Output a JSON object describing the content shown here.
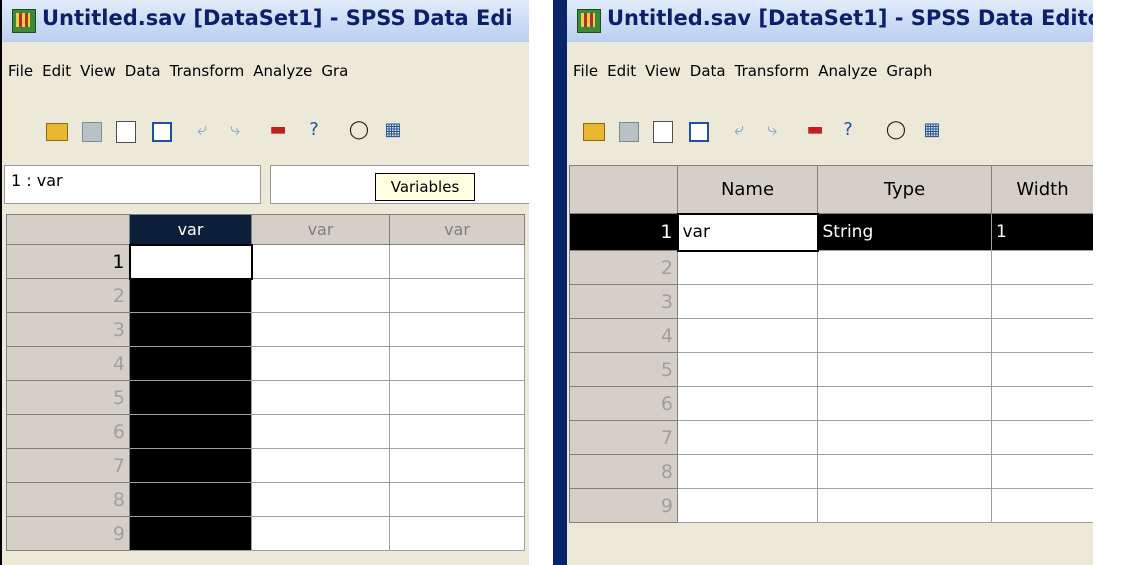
{
  "left_window": {
    "title": "Untitled.sav [DataSet1] - SPSS Data Edi",
    "menu": [
      "File",
      "Edit",
      "View",
      "Data",
      "Transform",
      "Analyze",
      "Gra"
    ],
    "cell_reference": "1 : var",
    "tooltip": "Variables",
    "columns": [
      "var",
      "var",
      "var"
    ],
    "rows": [
      "1",
      "2",
      "3",
      "4",
      "5",
      "6",
      "7",
      "8",
      "9"
    ]
  },
  "right_window": {
    "title": "Untitled.sav [DataSet1] - SPSS Data Edito",
    "menu": [
      "File",
      "Edit",
      "View",
      "Data",
      "Transform",
      "Analyze",
      "Graph"
    ],
    "columns": [
      "Name",
      "Type",
      "Width"
    ],
    "rows": [
      {
        "num": "1",
        "name": "var",
        "type": "String",
        "width": "1"
      },
      {
        "num": "2",
        "name": "",
        "type": "",
        "width": ""
      },
      {
        "num": "3",
        "name": "",
        "type": "",
        "width": ""
      },
      {
        "num": "4",
        "name": "",
        "type": "",
        "width": ""
      },
      {
        "num": "5",
        "name": "",
        "type": "",
        "width": ""
      },
      {
        "num": "6",
        "name": "",
        "type": "",
        "width": ""
      },
      {
        "num": "7",
        "name": "",
        "type": "",
        "width": ""
      },
      {
        "num": "8",
        "name": "",
        "type": "",
        "width": ""
      },
      {
        "num": "9",
        "name": "",
        "type": "",
        "width": ""
      }
    ]
  },
  "toolbar_icons": [
    "open-icon",
    "save-icon",
    "print-icon",
    "goto-case-icon",
    "undo-icon",
    "redo-icon",
    "insert-case-icon",
    "variables-icon",
    "find-icon",
    "insert-variable-icon"
  ],
  "colors": {
    "title_text": "#0b1f6b",
    "selection": "#000000",
    "tooltip_bg": "#ffffe1"
  }
}
